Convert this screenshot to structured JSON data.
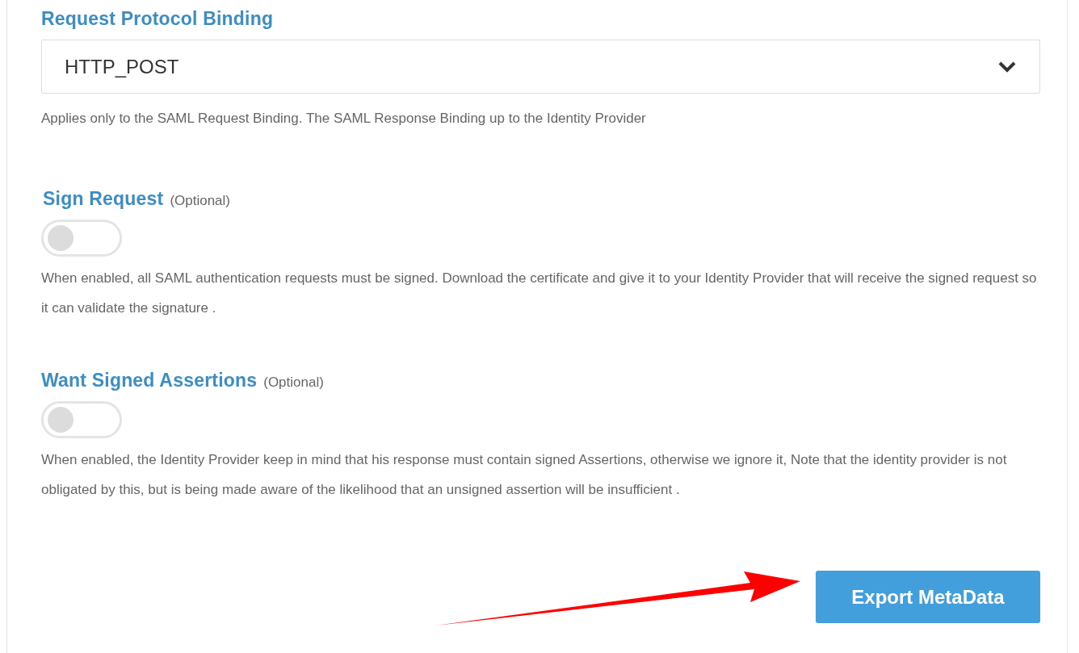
{
  "binding": {
    "label": "Request Protocol Binding",
    "value": "HTTP_POST",
    "help": "Applies only to the SAML Request Binding. The SAML Response Binding up to the Identity Provider"
  },
  "options": [
    {
      "label": "Sign Request",
      "note": "(Optional)",
      "on": false,
      "description": "When enabled, all SAML authentication requests must be signed. Download the certificate and give it to your Identity Provider that will receive the signed request so it can validate the signature ."
    },
    {
      "label": "Want Signed Assertions",
      "note": "(Optional)",
      "on": false,
      "description": "When enabled, the Identity Provider keep in mind that his response must contain signed Assertions, otherwise we ignore it, Note that the identity provider is not obligated by this, but is being made aware of the likelihood that an unsigned assertion will be insufficient ."
    }
  ],
  "export_button": "Export MetaData"
}
